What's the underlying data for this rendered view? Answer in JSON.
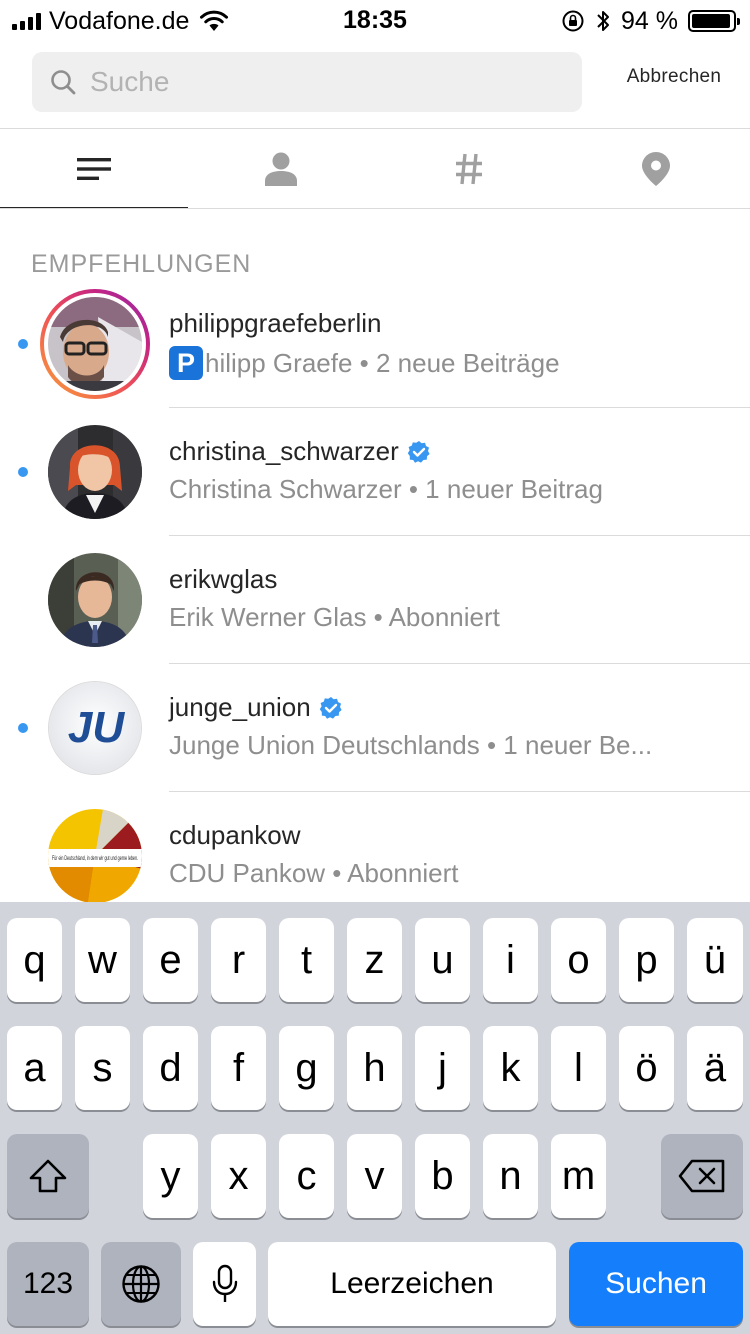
{
  "status_bar": {
    "carrier": "Vodafone.de",
    "time": "18:35",
    "battery_percent": "94 %",
    "battery_level": 0.94
  },
  "search": {
    "placeholder": "Suche",
    "value": "",
    "cancel_label": "Abbrechen"
  },
  "tabs": [
    {
      "icon": "top-results-icon",
      "active": true
    },
    {
      "icon": "person-icon",
      "active": false
    },
    {
      "icon": "hashtag-icon",
      "active": false
    },
    {
      "icon": "location-pin-icon",
      "active": false
    }
  ],
  "section_title": "EMPFEHLUNGEN",
  "results": [
    {
      "username": "philippgraefeberlin",
      "badge": "P",
      "subtitle": "hilipp Graefe • 2 neue Beiträge",
      "unread": true,
      "story": true,
      "verified": false
    },
    {
      "username": "christina_schwarzer",
      "subtitle": "Christina Schwarzer • 1 neuer Beitrag",
      "unread": true,
      "story": false,
      "verified": true
    },
    {
      "username": "erikwglas",
      "subtitle": "Erik Werner Glas • Abonniert",
      "unread": false,
      "story": false,
      "verified": false
    },
    {
      "username": "junge_union",
      "subtitle": "Junge Union Deutschlands • 1 neuer Be...",
      "unread": true,
      "story": false,
      "verified": true,
      "avatar_text": "JU"
    },
    {
      "username": "cdupankow",
      "subtitle": "CDU Pankow • Abonniert",
      "unread": false,
      "story": false,
      "verified": false,
      "avatar_text": "Für ein Deutschland, in dem wir gut und gerne leben."
    }
  ],
  "keyboard": {
    "row1": [
      "q",
      "w",
      "e",
      "r",
      "t",
      "z",
      "u",
      "i",
      "o",
      "p",
      "ü"
    ],
    "row2": [
      "a",
      "s",
      "d",
      "f",
      "g",
      "h",
      "j",
      "k",
      "l",
      "ö",
      "ä"
    ],
    "row3": [
      "y",
      "x",
      "c",
      "v",
      "b",
      "n",
      "m"
    ],
    "numbers_label": "123",
    "space_label": "Leerzeichen",
    "search_label": "Suchen"
  },
  "colors": {
    "accent_blue": "#3897f0",
    "keyboard_blue": "#147efb",
    "verified_blue": "#3897f0"
  }
}
